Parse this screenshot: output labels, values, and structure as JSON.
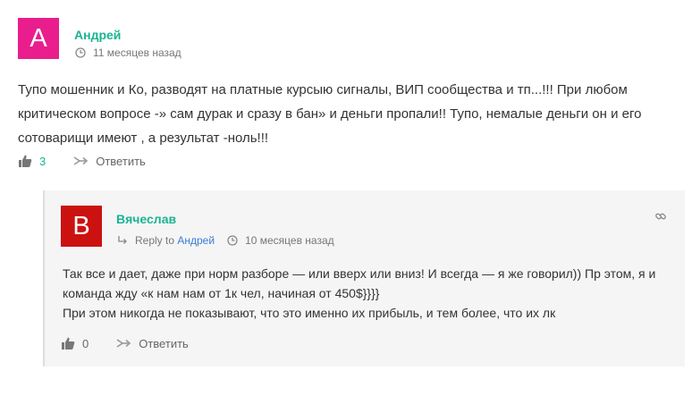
{
  "comment": {
    "avatar_letter": "А",
    "author": "Андрей",
    "time": "11 месяцев назад",
    "text": "Тупо мошенник и Ко, разводят на платные курсыю сигналы, ВИП сообщества и тп...!!! При любом критическом вопросе -» сам дурак и сразу в бан» и деньги пропали!! Тупо, немалые деньги он и его сотоварищи имеют , а результат -ноль!!!",
    "likes": "3",
    "reply_label": "Ответить"
  },
  "reply": {
    "avatar_letter": "В",
    "author": "Вячеслав",
    "reply_to_prefix": "Reply to",
    "reply_to_name": "Андрей",
    "time": "10 месяцев назад",
    "text_line1": "Так все и дает, даже при норм разборе — или вверх или вниз! И всегда — я же говорил)) Пр этом, я и команда жду «к нам нам от 1к чел, начиная от 450$}}}}",
    "text_line2": "При этом никогда не показывают, что это именно их прибыль, и тем более, что их лк",
    "likes": "0",
    "reply_label": "Ответить"
  },
  "icons": {
    "like": "thumbs-up-icon",
    "reply": "reply-arrow-icon",
    "clock": "clock-icon",
    "permalink": "link-icon"
  },
  "colors": {
    "avatar1": "#e91e8c",
    "avatar2": "#cc1111",
    "author": "#1ab394",
    "link": "#3a7bd5"
  }
}
